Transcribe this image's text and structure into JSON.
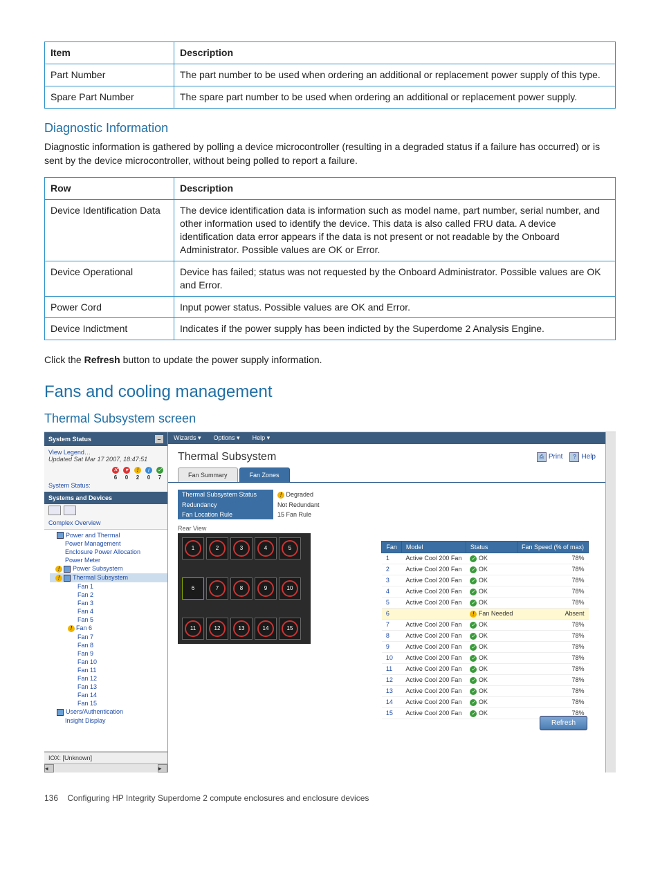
{
  "table1": {
    "h1": "Item",
    "h2": "Description",
    "rows": [
      {
        "a": "Part Number",
        "b": "The part number to be used when ordering an additional or replacement power supply of this type."
      },
      {
        "a": "Spare Part Number",
        "b": "The spare part number to be used when ordering an additional or replacement power supply."
      }
    ]
  },
  "diag": {
    "heading": "Diagnostic Information",
    "para": "Diagnostic information is gathered by polling a device microcontroller (resulting in a degraded status if a failure has occurred) or is sent by the device microcontroller, without being polled to report a failure."
  },
  "table2": {
    "h1": "Row",
    "h2": "Description",
    "rows": [
      {
        "a": "Device Identification Data",
        "b": "The device identification data is information such as model name, part number, serial number, and other information used to identify the device. This data is also called FRU data. A device identification data error appears if the data is not present or not readable by the Onboard Administrator. Possible values are OK or Error."
      },
      {
        "a": "Device Operational",
        "b": "Device has failed; status was not requested by the Onboard Administrator. Possible values are OK and Error."
      },
      {
        "a": "Power Cord",
        "b": "Input power status. Possible values are OK and Error."
      },
      {
        "a": "Device Indictment",
        "b": "Indicates if the power supply has been indicted by the Superdome 2 Analysis Engine."
      }
    ]
  },
  "refresh_line_pre": "Click the ",
  "refresh_line_bold": "Refresh",
  "refresh_line_post": " button to update the power supply information.",
  "h2a": "Fans and cooling management",
  "h2b": "Thermal Subsystem screen",
  "shot": {
    "left": {
      "sysstatus": "System Status",
      "view_legend": "View Legend…",
      "updated": "Updated Sat Mar 17 2007, 18:47:51",
      "status_label": "System Status:",
      "status_counts": [
        "6",
        "0",
        "2",
        "0",
        "7"
      ],
      "sd_title": "Systems and Devices",
      "complex": "Complex Overview",
      "tree": [
        {
          "lvl": 1,
          "txt": "Power and Thermal",
          "icon": "sq"
        },
        {
          "lvl": 2,
          "txt": "Power Management"
        },
        {
          "lvl": 2,
          "txt": "Enclosure Power Allocation"
        },
        {
          "lvl": 2,
          "txt": "Power Meter"
        },
        {
          "lvl": 2,
          "txt": "Power Subsystem",
          "warn": true,
          "icon": "sq"
        },
        {
          "lvl": 2,
          "txt": "Thermal Subsystem",
          "warn": true,
          "icon": "sq",
          "sel": true
        },
        {
          "lvl": 3,
          "txt": "Fan 1"
        },
        {
          "lvl": 3,
          "txt": "Fan 2"
        },
        {
          "lvl": 3,
          "txt": "Fan 3"
        },
        {
          "lvl": 3,
          "txt": "Fan 4"
        },
        {
          "lvl": 3,
          "txt": "Fan 5"
        },
        {
          "lvl": 3,
          "txt": "Fan 6",
          "warn": true
        },
        {
          "lvl": 3,
          "txt": "Fan 7"
        },
        {
          "lvl": 3,
          "txt": "Fan 8"
        },
        {
          "lvl": 3,
          "txt": "Fan 9"
        },
        {
          "lvl": 3,
          "txt": "Fan 10"
        },
        {
          "lvl": 3,
          "txt": "Fan 11"
        },
        {
          "lvl": 3,
          "txt": "Fan 12"
        },
        {
          "lvl": 3,
          "txt": "Fan 13"
        },
        {
          "lvl": 3,
          "txt": "Fan 14"
        },
        {
          "lvl": 3,
          "txt": "Fan 15"
        },
        {
          "lvl": 1,
          "txt": "Users/Authentication",
          "icon": "sq"
        },
        {
          "lvl": 2,
          "txt": "Insight Display"
        }
      ],
      "iox": "IOX: [Unknown]"
    },
    "menu": [
      "Wizards ▾",
      "Options ▾",
      "Help ▾"
    ],
    "title": "Thermal Subsystem",
    "print": "Print",
    "help": "Help",
    "tabs": [
      "Fan Summary",
      "Fan Zones"
    ],
    "summary": [
      {
        "k": "Thermal Subsystem Status",
        "v": "Degraded",
        "warn": true
      },
      {
        "k": "Redundancy",
        "v": "Not Redundant"
      },
      {
        "k": "Fan Location Rule",
        "v": "15 Fan Rule"
      }
    ],
    "rear": "Rear View",
    "fan_labels_r1": [
      "1",
      "2",
      "3",
      "4",
      "5"
    ],
    "fan_labels_r2": [
      "6",
      "7",
      "8",
      "9",
      "10"
    ],
    "fan_labels_r3": [
      "11",
      "12",
      "13",
      "14",
      "15"
    ],
    "ft": {
      "h": [
        "Fan",
        "Model",
        "Status",
        "Fan Speed (% of max)"
      ],
      "rows": [
        {
          "n": "1",
          "m": "Active Cool 200 Fan",
          "s": "OK",
          "p": "78%"
        },
        {
          "n": "2",
          "m": "Active Cool 200 Fan",
          "s": "OK",
          "p": "78%"
        },
        {
          "n": "3",
          "m": "Active Cool 200 Fan",
          "s": "OK",
          "p": "78%"
        },
        {
          "n": "4",
          "m": "Active Cool 200 Fan",
          "s": "OK",
          "p": "78%"
        },
        {
          "n": "5",
          "m": "Active Cool 200 Fan",
          "s": "OK",
          "p": "78%"
        },
        {
          "n": "6",
          "m": "",
          "s": "Fan Needed",
          "p": "Absent",
          "absent": true
        },
        {
          "n": "7",
          "m": "Active Cool 200 Fan",
          "s": "OK",
          "p": "78%"
        },
        {
          "n": "8",
          "m": "Active Cool 200 Fan",
          "s": "OK",
          "p": "78%"
        },
        {
          "n": "9",
          "m": "Active Cool 200 Fan",
          "s": "OK",
          "p": "78%"
        },
        {
          "n": "10",
          "m": "Active Cool 200 Fan",
          "s": "OK",
          "p": "78%"
        },
        {
          "n": "11",
          "m": "Active Cool 200 Fan",
          "s": "OK",
          "p": "78%"
        },
        {
          "n": "12",
          "m": "Active Cool 200 Fan",
          "s": "OK",
          "p": "78%"
        },
        {
          "n": "13",
          "m": "Active Cool 200 Fan",
          "s": "OK",
          "p": "78%"
        },
        {
          "n": "14",
          "m": "Active Cool 200 Fan",
          "s": "OK",
          "p": "78%"
        },
        {
          "n": "15",
          "m": "Active Cool 200 Fan",
          "s": "OK",
          "p": "78%"
        }
      ]
    },
    "refresh_btn": "Refresh"
  },
  "footer_num": "136",
  "footer_txt": "Configuring HP Integrity Superdome 2 compute enclosures and enclosure devices"
}
